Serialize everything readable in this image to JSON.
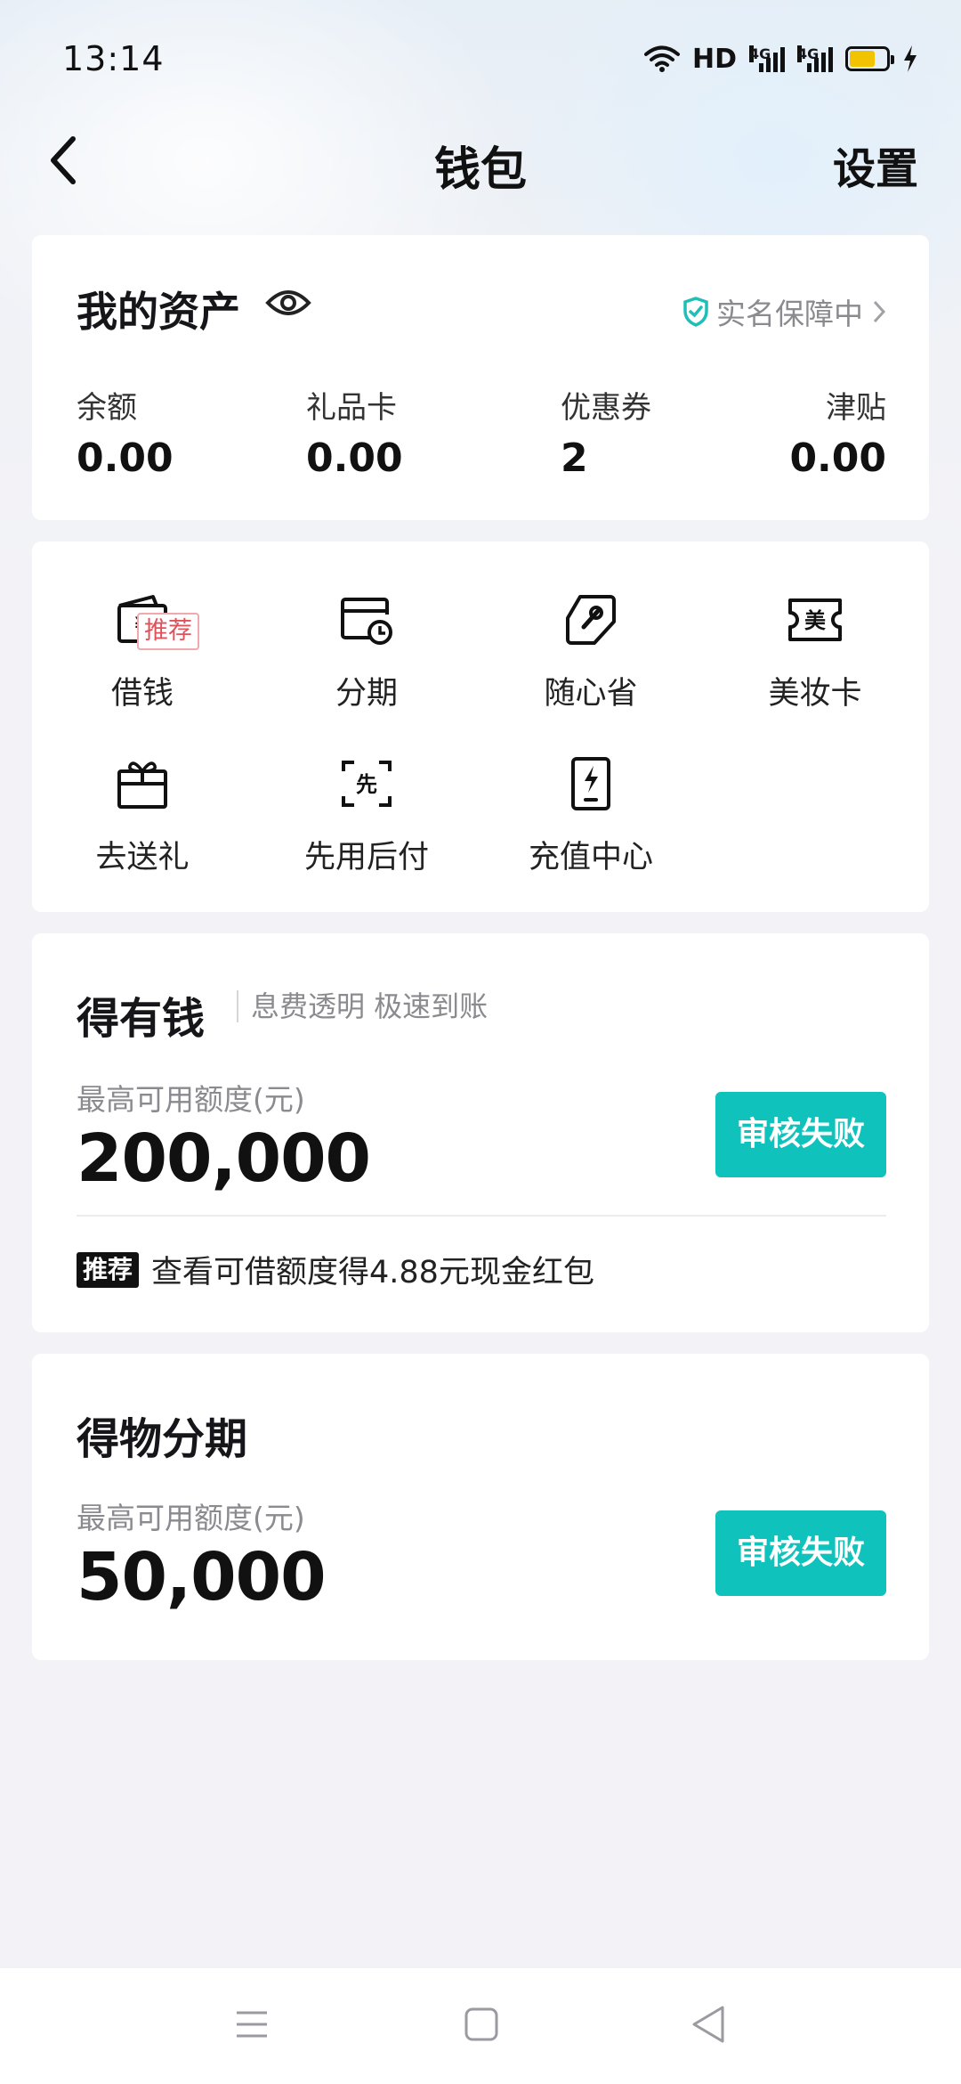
{
  "status_bar": {
    "time": "13:14",
    "network": "HD",
    "signal_1": "4G",
    "signal_2": "4G",
    "battery_color": "#f2c300"
  },
  "header": {
    "title": "钱包",
    "settings_label": "设置"
  },
  "assets": {
    "title": "我的资产",
    "realname_label": "实名保障中",
    "items": [
      {
        "label": "余额",
        "value": "0.00"
      },
      {
        "label": "礼品卡",
        "value": "0.00"
      },
      {
        "label": "优惠券",
        "value": "2"
      },
      {
        "label": "津贴",
        "value": "0.00"
      }
    ]
  },
  "services": [
    {
      "label": "借钱",
      "icon": "yuan-wallet-icon",
      "tag": "推荐"
    },
    {
      "label": "分期",
      "icon": "calendar-clock-icon"
    },
    {
      "label": "随心省",
      "icon": "coupon-tag-icon"
    },
    {
      "label": "美妆卡",
      "icon": "beauty-ticket-icon",
      "icon_text": "美"
    },
    {
      "label": "去送礼",
      "icon": "gift-box-icon"
    },
    {
      "label": "先用后付",
      "icon": "pay-later-icon",
      "icon_text": "先"
    },
    {
      "label": "充值中心",
      "icon": "phone-charge-icon"
    }
  ],
  "loan": {
    "title": "得有钱",
    "subtitle": "息费透明 极速到账",
    "quota_label": "最高可用额度(元)",
    "quota_value": "200,000",
    "button_label": "审核失败",
    "rec_badge": "推荐",
    "rec_text": "查看可借额度得4.88元现金红包"
  },
  "installment": {
    "title": "得物分期",
    "quota_label": "最高可用额度(元)",
    "quota_value": "50,000",
    "button_label": "审核失败"
  },
  "colors": {
    "accent": "#0fc3bc",
    "tag_red": "#e0525a",
    "shield": "#1fbfb7"
  }
}
